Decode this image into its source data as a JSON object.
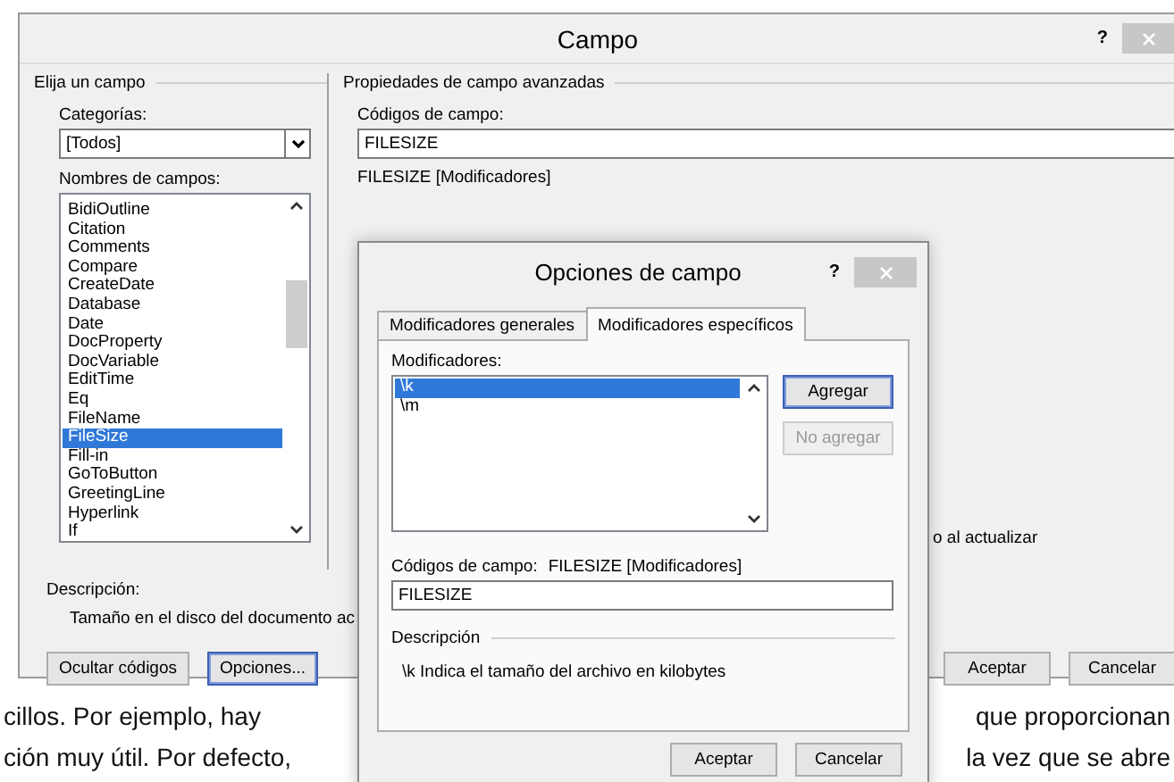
{
  "field_dialog": {
    "title": "Campo",
    "help": "?",
    "choose": {
      "heading": "Elija un campo",
      "categories_label": "Categorías:",
      "category_value": "[Todos]",
      "names_label": "Nombres de campos:",
      "field_names": [
        {
          "label": "BidiOutline",
          "selected": false
        },
        {
          "label": "Citation",
          "selected": false
        },
        {
          "label": "Comments",
          "selected": false
        },
        {
          "label": "Compare",
          "selected": false
        },
        {
          "label": "CreateDate",
          "selected": false
        },
        {
          "label": "Database",
          "selected": false
        },
        {
          "label": "Date",
          "selected": false
        },
        {
          "label": "DocProperty",
          "selected": false
        },
        {
          "label": "DocVariable",
          "selected": false
        },
        {
          "label": "EditTime",
          "selected": false
        },
        {
          "label": "Eq",
          "selected": false
        },
        {
          "label": "FileName",
          "selected": false
        },
        {
          "label": "FileSize",
          "selected": true
        },
        {
          "label": "Fill-in",
          "selected": false
        },
        {
          "label": "GoToButton",
          "selected": false
        },
        {
          "label": "GreetingLine",
          "selected": false
        },
        {
          "label": "Hyperlink",
          "selected": false
        },
        {
          "label": "If",
          "selected": false
        }
      ]
    },
    "advanced": {
      "heading": "Propiedades de campo avanzadas",
      "codes_label": "Códigos de campo:",
      "codes_value": "FILESIZE",
      "syntax": "FILESIZE [Modificadores]",
      "option_fragment": "o al actualizar"
    },
    "description": {
      "label": "Descripción:",
      "text": "Tamaño en el disco del documento ac"
    },
    "left_buttons": [
      {
        "label": "Ocultar códigos",
        "default": false
      },
      {
        "label": "Opciones...",
        "default": true
      }
    ],
    "right_buttons": [
      {
        "label": "Aceptar",
        "default": false
      },
      {
        "label": "Cancelar",
        "default": false
      }
    ]
  },
  "options_dialog": {
    "title": "Opciones de campo",
    "help": "?",
    "tabs": [
      {
        "label": "Modificadores generales",
        "selected": false
      },
      {
        "label": "Modificadores específicos",
        "selected": true
      }
    ],
    "switches_label": "Modificadores:",
    "switches": [
      {
        "label": "\\k",
        "selected": true
      },
      {
        "label": "\\m",
        "selected": false
      }
    ],
    "actions": [
      {
        "label": "Agregar",
        "default": true,
        "disabled": false
      },
      {
        "label": "No agregar",
        "default": false,
        "disabled": true
      }
    ],
    "codes_label": "Códigos de campo:",
    "codes_syntax": "FILESIZE [Modificadores]",
    "codes_value": "FILESIZE",
    "description_heading": "Descripción",
    "description_text": "\\k Indica el tamaño del archivo en kilobytes",
    "buttons": [
      {
        "label": "Aceptar",
        "default": false
      },
      {
        "label": "Cancelar",
        "default": false
      }
    ]
  },
  "document": {
    "lines": [
      {
        "left": "cillos. Por ejemplo, hay",
        "right": "que proporcionan"
      },
      {
        "left": "ción muy útil. Por defecto,",
        "right": "la vez que se abre"
      }
    ]
  }
}
